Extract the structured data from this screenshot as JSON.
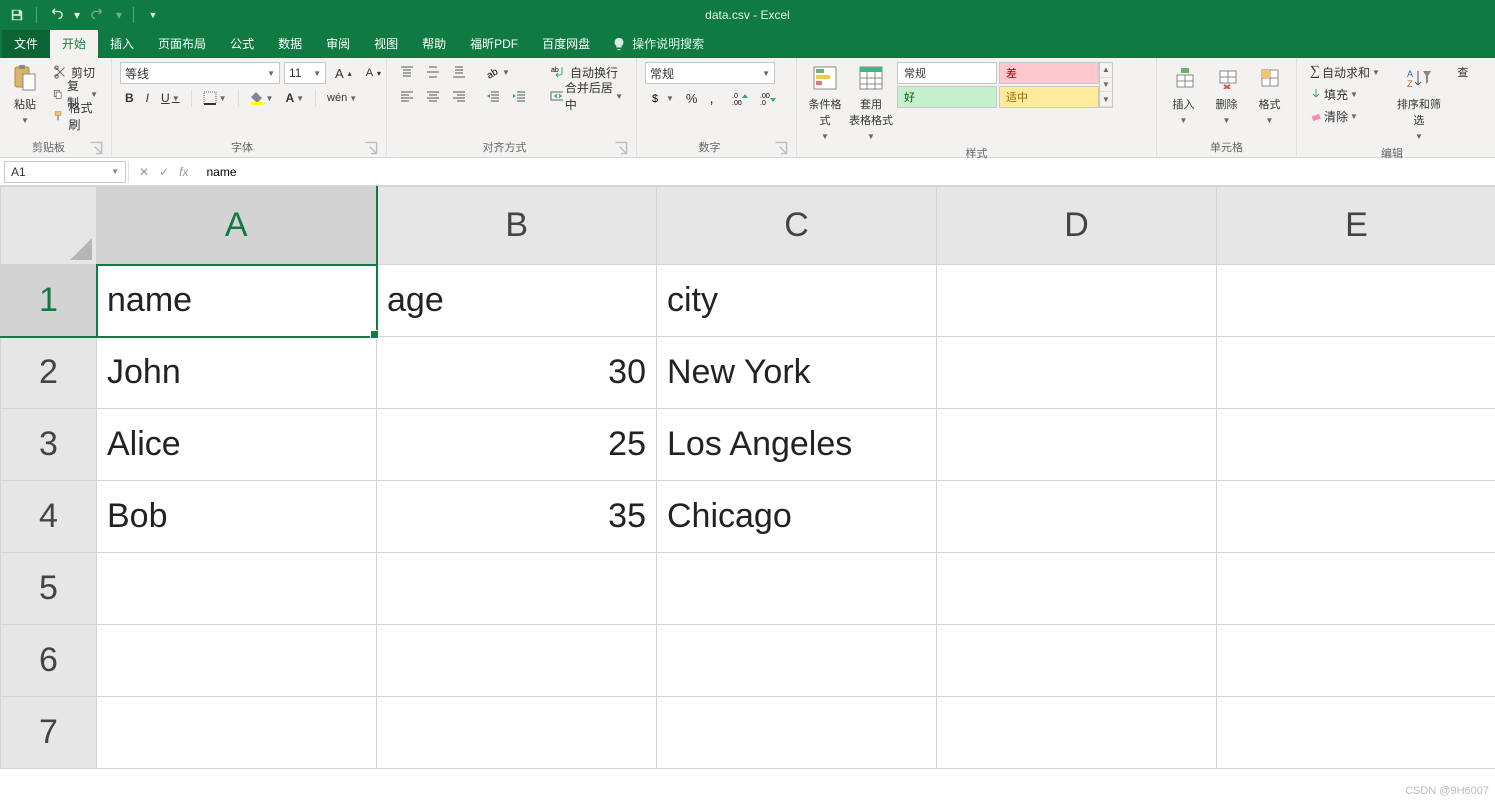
{
  "window": {
    "title": "data.csv  -  Excel"
  },
  "qat": {
    "save": "保存",
    "undo": "撤销",
    "redo": "重做"
  },
  "tabs": {
    "file": "文件",
    "home": "开始",
    "insert": "插入",
    "layout": "页面布局",
    "formulas": "公式",
    "data": "数据",
    "review": "审阅",
    "view": "视图",
    "help": "帮助",
    "foxit": "福昕PDF",
    "baidu": "百度网盘",
    "tell": "操作说明搜索"
  },
  "ribbon": {
    "clipboard": {
      "label": "剪贴板",
      "paste": "粘贴",
      "cut": "剪切",
      "copy": "复制",
      "painter": "格式刷"
    },
    "font": {
      "label": "字体",
      "name": "等线",
      "size": "11",
      "bold": "B",
      "italic": "I",
      "underline": "U",
      "phonetic": "wén"
    },
    "align": {
      "label": "对齐方式",
      "wrap": "自动换行",
      "merge": "合并后居中"
    },
    "number": {
      "label": "数字",
      "format": "常规"
    },
    "styles": {
      "label": "样式",
      "cond": "条件格式",
      "table": "套用\n表格格式",
      "normal": "常规",
      "bad": "差",
      "good": "好",
      "medium": "适中"
    },
    "cells": {
      "label": "单元格",
      "insert": "插入",
      "delete": "删除",
      "format": "格式"
    },
    "editing": {
      "label": "编辑",
      "autosum": "自动求和",
      "fill": "填充",
      "clear": "清除",
      "sortfilter": "排序和筛选",
      "find": "查"
    }
  },
  "formulaBar": {
    "nameBox": "A1",
    "value": "name"
  },
  "sheet": {
    "columns": [
      "A",
      "B",
      "C",
      "D",
      "E"
    ],
    "rowNumbers": [
      "1",
      "2",
      "3",
      "4",
      "5",
      "6",
      "7"
    ],
    "selectedCell": "A1",
    "cells": {
      "A1": "name",
      "B1": "age",
      "C1": "city",
      "A2": "John",
      "B2": "30",
      "C2": "New York",
      "A3": "Alice",
      "B3": "25",
      "C3": "Los Angeles",
      "A4": "Bob",
      "B4": "35",
      "C4": "Chicago"
    }
  },
  "watermark": "CSDN @9H6007"
}
